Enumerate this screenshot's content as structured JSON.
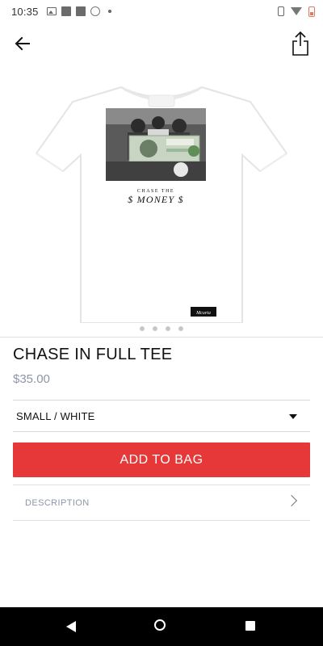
{
  "status_bar": {
    "time": "10:35"
  },
  "product": {
    "title": "CHASE IN FULL TEE",
    "price": "$35.00",
    "image": {
      "graphic_text_line1": "CHASE THE",
      "graphic_text_line2": "$ MONEY $",
      "tag_text": "Mcurta"
    },
    "carousel_dots": 4
  },
  "variant": {
    "selected": "SMALL / WHITE"
  },
  "actions": {
    "add_to_bag": "ADD TO BAG"
  },
  "description": {
    "label": "DESCRIPTION"
  },
  "colors": {
    "accent": "#e63838",
    "price": "#8e95a8",
    "nav_bar": "#000000"
  }
}
